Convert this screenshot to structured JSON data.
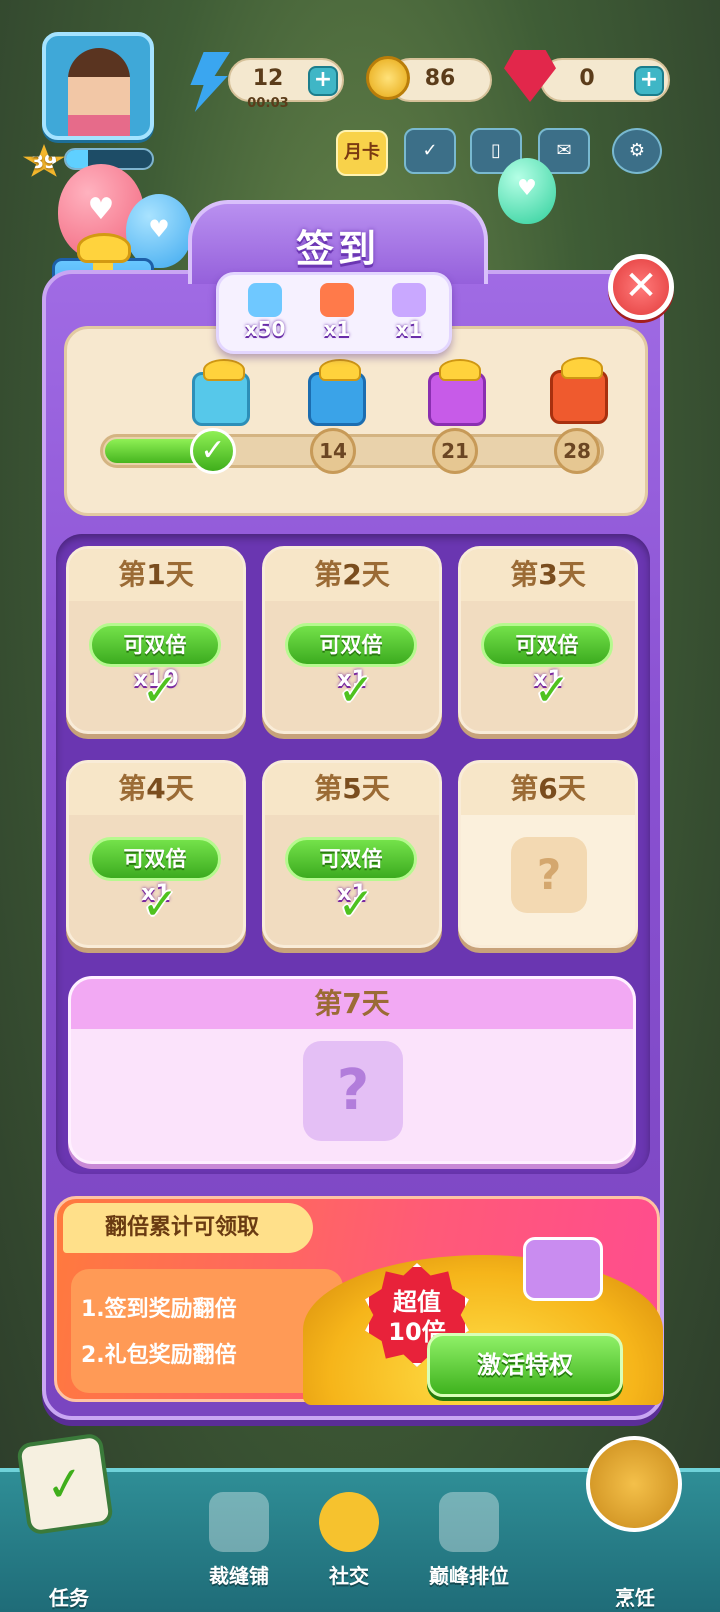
{
  "hud": {
    "level": "39",
    "xp_fraction": 0.25,
    "energy": {
      "value": "12",
      "timer": "00:03",
      "plus": "+"
    },
    "coins": {
      "value": "86"
    },
    "gems": {
      "value": "0",
      "plus": "+"
    },
    "icons": [
      "lightning-icon",
      "coin-icon",
      "gem-icon"
    ],
    "top_buttons": {
      "monthly_card": "月卡"
    }
  },
  "dialog": {
    "title": "签到",
    "close": "✕"
  },
  "tooltip": {
    "items": [
      {
        "icon": "energy-bolt-icon",
        "count": "x50",
        "color": "#6fc8ff"
      },
      {
        "icon": "treasure-chest-icon",
        "count": "x1",
        "color": "#ff7a4a"
      },
      {
        "icon": "crystal-icon",
        "count": "x1",
        "color": "#c9a8ff"
      }
    ]
  },
  "progress": {
    "milestones": [
      "",
      "14",
      "21",
      "28"
    ],
    "done_mark": "✓",
    "filled_fraction": 0.25,
    "gift_colors": [
      "#56c8ea",
      "#3aa3e8",
      "#c75be8",
      "#ef5a2e"
    ]
  },
  "days": [
    {
      "prefix": "第",
      "num": "1",
      "suffix": "天",
      "badge": "可双倍",
      "count": "x10",
      "check": "✓",
      "claimed": true
    },
    {
      "prefix": "第",
      "num": "2",
      "suffix": "天",
      "badge": "可双倍",
      "count": "x1",
      "check": "✓",
      "claimed": true
    },
    {
      "prefix": "第",
      "num": "3",
      "suffix": "天",
      "badge": "可双倍",
      "count": "x1",
      "check": "✓",
      "claimed": true
    },
    {
      "prefix": "第",
      "num": "4",
      "suffix": "天",
      "badge": "可双倍",
      "count": "x1",
      "check": "✓",
      "claimed": true
    },
    {
      "prefix": "第",
      "num": "5",
      "suffix": "天",
      "badge": "可双倍",
      "count": "x1",
      "check": "✓",
      "claimed": true
    },
    {
      "prefix": "第",
      "num": "6",
      "suffix": "天",
      "mystery": "?",
      "claimed": false
    }
  ],
  "day7": {
    "prefix": "第",
    "num": "7",
    "suffix": "天",
    "mystery": "?"
  },
  "promo": {
    "tab": "翻倍累计可领取",
    "line1": "1.签到奖励翻倍",
    "line2": "2.礼包奖励翻倍",
    "badge_line1": "超值",
    "badge_line2": "10倍",
    "button": "激活特权"
  },
  "nav": {
    "items": [
      {
        "label": "任务",
        "icon": "task-clipboard-icon"
      },
      {
        "label": "裁缝铺",
        "icon": "tailor-icon"
      },
      {
        "label": "社交",
        "icon": "social-icon"
      },
      {
        "label": "巅峰排位",
        "icon": "trophy-icon"
      },
      {
        "label": "烹饪",
        "icon": "cooking-pot-icon"
      }
    ]
  }
}
